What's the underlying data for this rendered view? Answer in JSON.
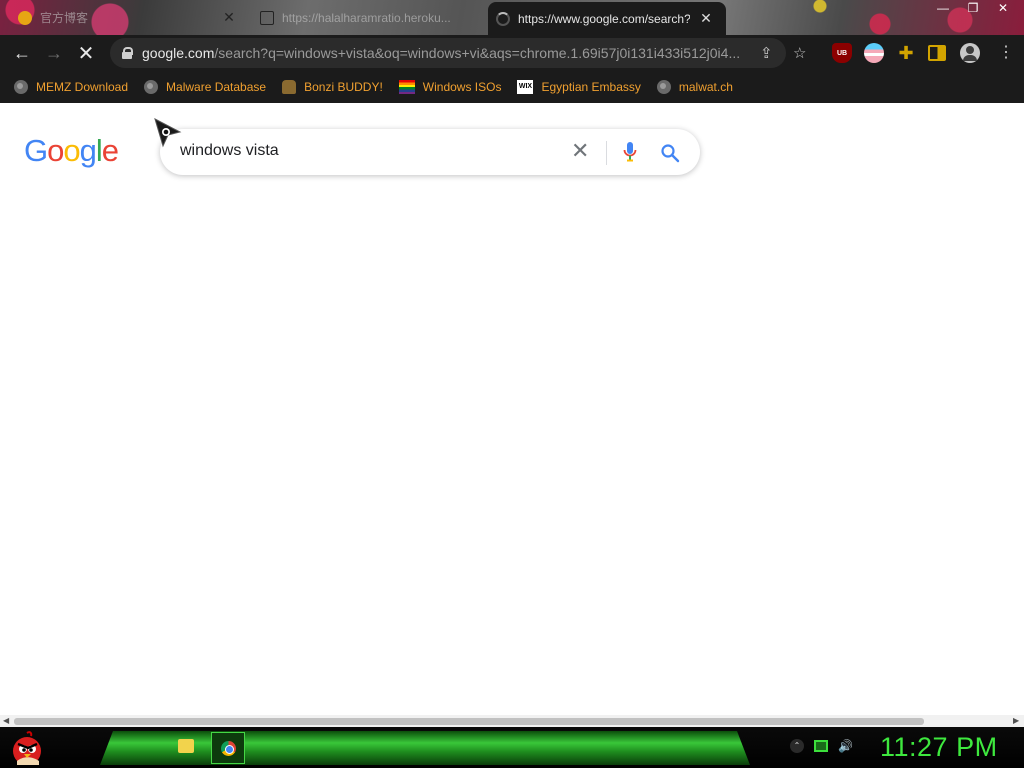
{
  "tabs": [
    {
      "title": "官方博客",
      "active": false
    },
    {
      "title": "https://halalharamratio.heroku...",
      "active": false
    },
    {
      "title": "https://www.google.com/search?",
      "active": true
    }
  ],
  "window_controls": {
    "minimize": "—",
    "maximize": "❐",
    "close": "✕"
  },
  "toolbar": {
    "url_host": "google.com",
    "url_rest": "/search?q=windows+vista&oq=windows+vi&aqs=chrome.1.69i57j0i131i433i512j0i4...",
    "ublock_label": "UB"
  },
  "bookmarks": [
    {
      "label": "MEMZ Download",
      "icon": "globe-icon"
    },
    {
      "label": "Malware Database",
      "icon": "globe-icon"
    },
    {
      "label": "Bonzi BUDDY!",
      "icon": "bonzi-icon"
    },
    {
      "label": "Windows ISOs",
      "icon": "rainbow-flag-icon"
    },
    {
      "label": "Egyptian Embassy",
      "icon": "wix-icon"
    },
    {
      "label": "malwat.ch",
      "icon": "globe-icon"
    }
  ],
  "google": {
    "logo_letters": [
      "G",
      "o",
      "o",
      "g",
      "l",
      "e"
    ],
    "logo_colors": [
      "#4285f4",
      "#ea4335",
      "#fbbc05",
      "#4285f4",
      "#34a853",
      "#ea4335"
    ],
    "search_value": "windows vista"
  },
  "taskbar": {
    "clock": "11:27 PM",
    "accent": "#3ee83e"
  }
}
